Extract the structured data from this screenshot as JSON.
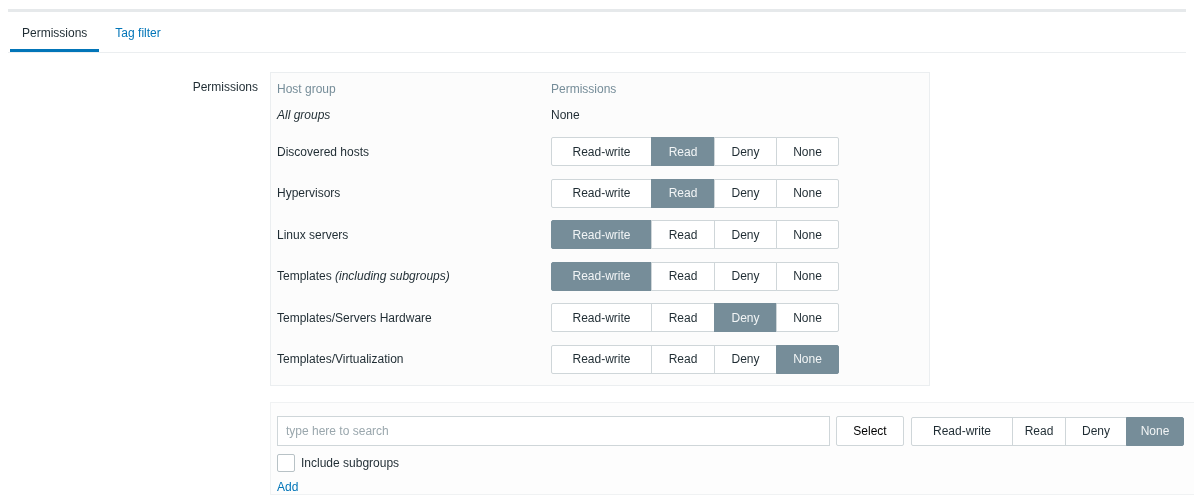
{
  "tabs": [
    {
      "label": "Permissions",
      "selected": true
    },
    {
      "label": "Tag filter",
      "selected": false
    }
  ],
  "form": {
    "label": "Permissions",
    "table": {
      "columns": [
        "Host group",
        "Permissions"
      ],
      "rows": [
        {
          "kind": "all",
          "group": "All groups",
          "permission": "None"
        },
        {
          "kind": "choice",
          "group": "Discovered hosts",
          "options": [
            {
              "label": "Read-write",
              "selected": false
            },
            {
              "label": "Read",
              "selected": true
            },
            {
              "label": "Deny",
              "selected": false
            },
            {
              "label": "None",
              "selected": false
            }
          ]
        },
        {
          "kind": "choice",
          "group": "Hypervisors",
          "options": [
            {
              "label": "Read-write",
              "selected": false
            },
            {
              "label": "Read",
              "selected": true
            },
            {
              "label": "Deny",
              "selected": false
            },
            {
              "label": "None",
              "selected": false
            }
          ]
        },
        {
          "kind": "choice",
          "group": "Linux servers",
          "options": [
            {
              "label": "Read-write",
              "selected": true
            },
            {
              "label": "Read",
              "selected": false
            },
            {
              "label": "Deny",
              "selected": false
            },
            {
              "label": "None",
              "selected": false
            }
          ]
        },
        {
          "kind": "choice",
          "group": "Templates *(including subgroups)*",
          "options": [
            {
              "label": "Read-write",
              "selected": true
            },
            {
              "label": "Read",
              "selected": false
            },
            {
              "label": "Deny",
              "selected": false
            },
            {
              "label": "None",
              "selected": false
            }
          ]
        },
        {
          "kind": "choice",
          "group": "Templates/Servers Hardware",
          "options": [
            {
              "label": "Read-write",
              "selected": false
            },
            {
              "label": "Read",
              "selected": false
            },
            {
              "label": "Deny",
              "selected": true
            },
            {
              "label": "None",
              "selected": false
            }
          ]
        },
        {
          "kind": "choice",
          "group": "Templates/Virtualization",
          "options": [
            {
              "label": "Read-write",
              "selected": false
            },
            {
              "label": "Read",
              "selected": false
            },
            {
              "label": "Deny",
              "selected": false
            },
            {
              "label": "None",
              "selected": true
            }
          ]
        }
      ]
    },
    "add": {
      "search": {
        "placeholder": "type here to search"
      },
      "select_button": "Select",
      "options": [
        {
          "label": "Read-write",
          "selected": false
        },
        {
          "label": "Read",
          "selected": false
        },
        {
          "label": "Deny",
          "selected": false
        },
        {
          "label": "None",
          "selected": true
        }
      ],
      "include_subgroups": {
        "label": "Include subgroups",
        "checked": false
      },
      "add_link": "Add"
    }
  }
}
